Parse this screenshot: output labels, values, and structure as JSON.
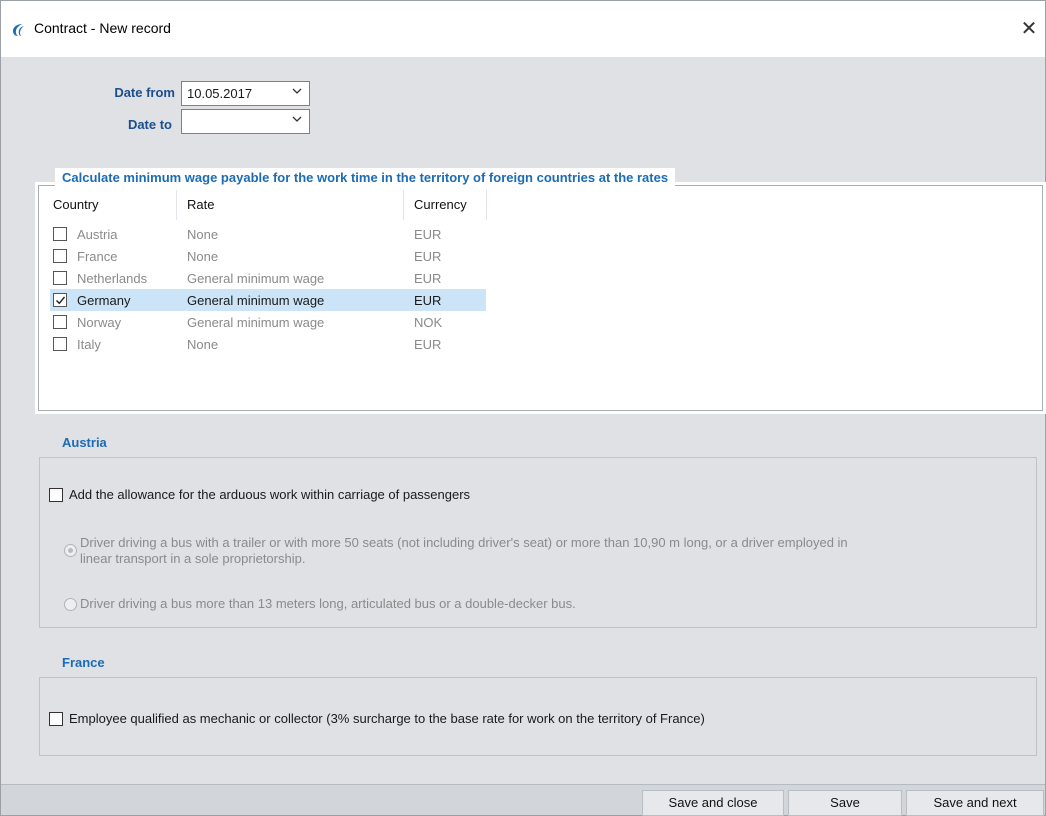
{
  "window": {
    "title": "Contract - New record",
    "close_glyph": "✕"
  },
  "dates": {
    "from_label": "Date from",
    "from_value": "10.05.2017",
    "to_label": "Date to",
    "to_value": ""
  },
  "rates_group": {
    "title": "Calculate minimum wage payable for the work time in the territory of foreign countries at the rates",
    "columns": [
      "Country",
      "Rate",
      "Currency"
    ],
    "rows": [
      {
        "country": "Austria",
        "rate": "None",
        "currency": "EUR",
        "checked": false
      },
      {
        "country": "France",
        "rate": "None",
        "currency": "EUR",
        "checked": false
      },
      {
        "country": "Netherlands",
        "rate": "General minimum wage",
        "currency": "EUR",
        "checked": false
      },
      {
        "country": "Germany",
        "rate": "General minimum wage",
        "currency": "EUR",
        "checked": true
      },
      {
        "country": "Norway",
        "rate": "General minimum wage",
        "currency": "NOK",
        "checked": false
      },
      {
        "country": "Italy",
        "rate": "None",
        "currency": "EUR",
        "checked": false
      }
    ]
  },
  "austria": {
    "title": "Austria",
    "allowance_label": "Add the allowance for the arduous work within carriage of passengers",
    "option1_line1": "Driver driving a bus with a trailer or with more 50 seats (not including driver's seat) or more than 10,90 m long, or a driver employed in",
    "option1_line2": "linear transport in a sole proprietorship.",
    "option2": "Driver driving a bus more than 13 meters long, articulated bus or a double-decker bus."
  },
  "france": {
    "title": "France",
    "mechanic_label": "Employee qualified as mechanic or collector (3% surcharge to the base rate for work on the territory of France)"
  },
  "footer": {
    "save_close": "Save and close",
    "save": "Save",
    "save_next": "Save and next"
  },
  "colors": {
    "accent": "#1b6cb5",
    "selected_row": "#cce4f7",
    "background": "#dfe1e5"
  }
}
